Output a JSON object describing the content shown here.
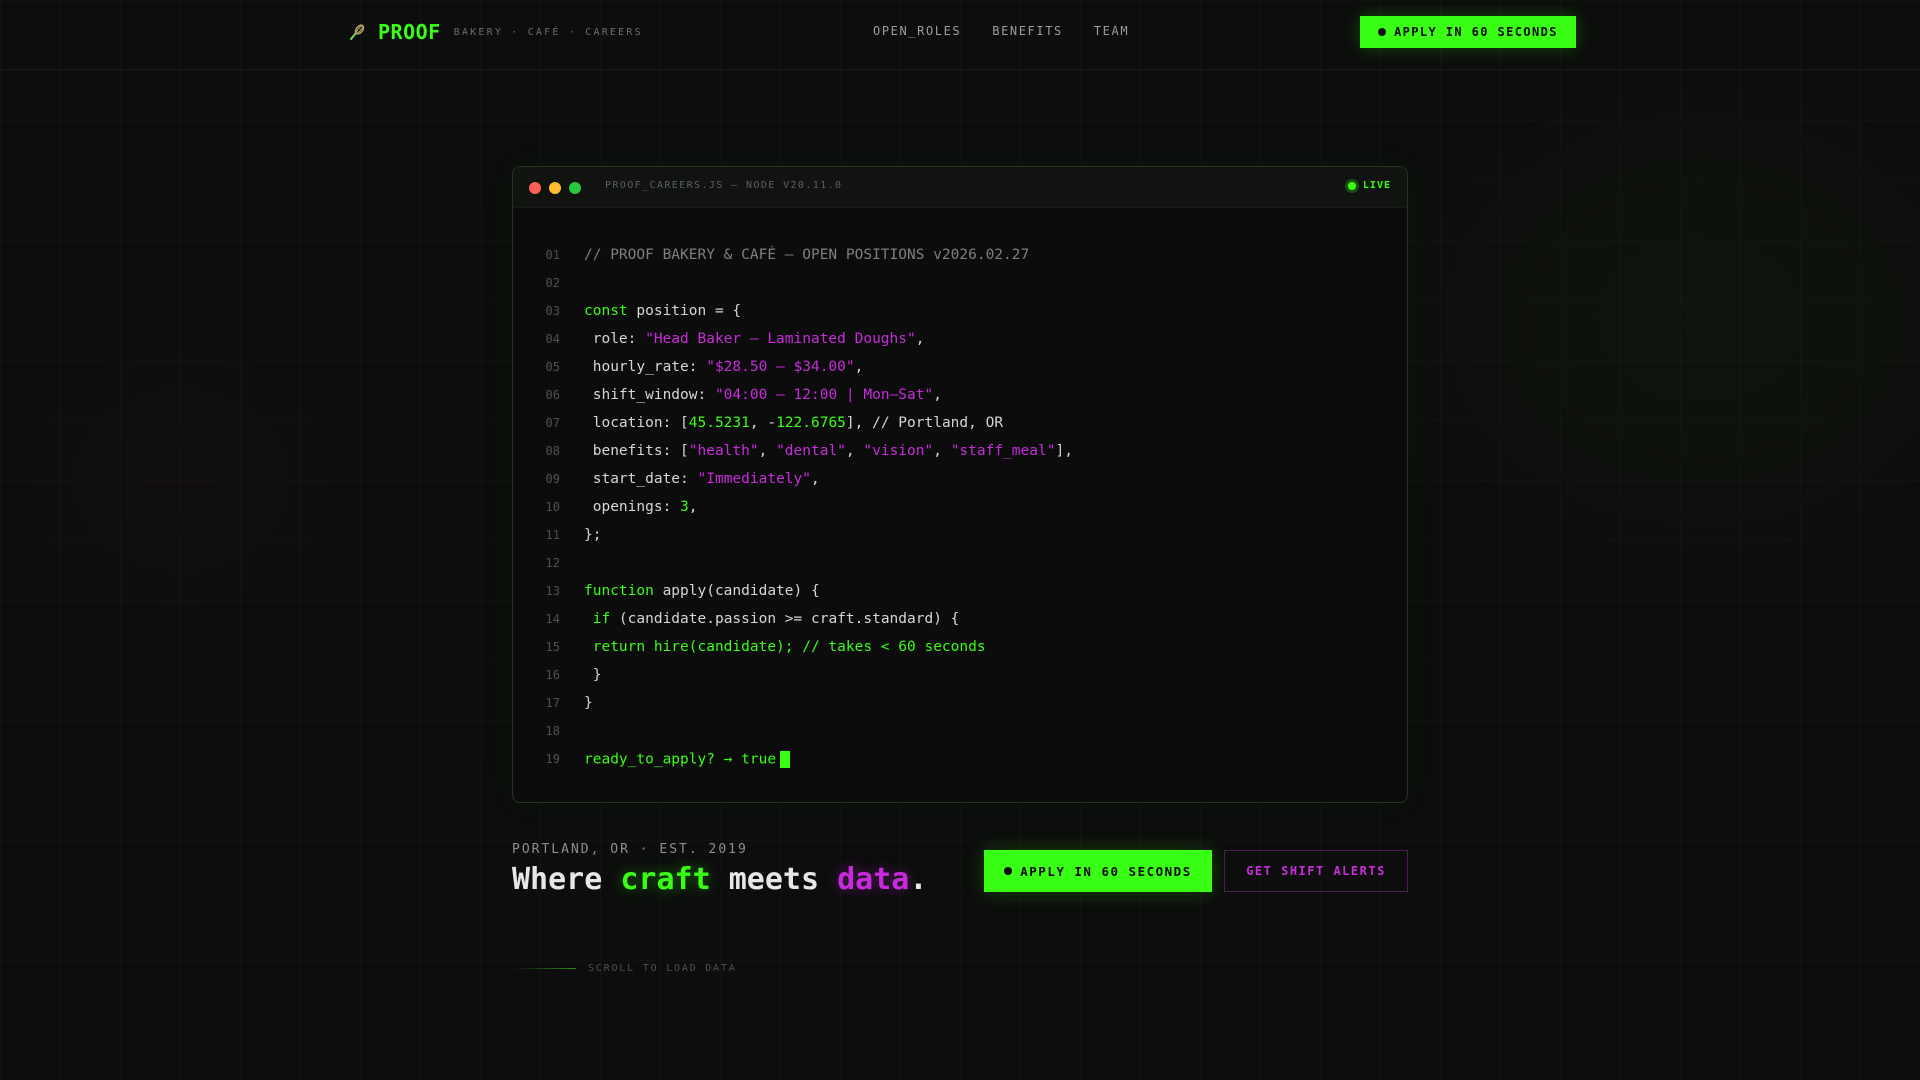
{
  "nav": {
    "brand_name": "PROOF",
    "brand_tagline": "BAKERY · CAFÉ · CAREERS",
    "brand_icon": "whisk-icon",
    "links": [
      "OPEN_ROLES",
      "BENEFITS",
      "TEAM"
    ],
    "cta_label": "APPLY IN 60 SECONDS"
  },
  "window": {
    "title": "PROOF_CAREERS.JS — NODE V20.11.0",
    "status_label": "LIVE",
    "lines": [
      {
        "n": "01",
        "tokens": [
          [
            "// PROOF BAKERY & CAFÉ — OPEN POSITIONS v2026.02.27",
            "com"
          ]
        ]
      },
      {
        "n": "02",
        "tokens": []
      },
      {
        "n": "03",
        "tokens": [
          [
            "const",
            "kw"
          ],
          [
            " position = {",
            "txt"
          ]
        ]
      },
      {
        "n": "04",
        "tokens": [
          [
            " role: ",
            "txt"
          ],
          [
            "\"Head Baker — Laminated Doughs\"",
            "str"
          ],
          [
            ",",
            "txt"
          ]
        ]
      },
      {
        "n": "05",
        "tokens": [
          [
            " hourly_rate: ",
            "txt"
          ],
          [
            "\"$28.50 – $34.00\"",
            "str"
          ],
          [
            ",",
            "txt"
          ]
        ]
      },
      {
        "n": "06",
        "tokens": [
          [
            " shift_window: ",
            "txt"
          ],
          [
            "\"04:00 – 12:00 | Mon–Sat\"",
            "str"
          ],
          [
            ",",
            "txt"
          ]
        ]
      },
      {
        "n": "07",
        "tokens": [
          [
            " location: [",
            "txt"
          ],
          [
            "45.5231",
            "num"
          ],
          [
            ", -",
            "txt"
          ],
          [
            "122.6765",
            "num"
          ],
          [
            "], // Portland, OR",
            "txt"
          ]
        ]
      },
      {
        "n": "08",
        "tokens": [
          [
            " benefits: [",
            "txt"
          ],
          [
            "\"health\"",
            "str"
          ],
          [
            ", ",
            "txt"
          ],
          [
            "\"dental\"",
            "str"
          ],
          [
            ", ",
            "txt"
          ],
          [
            "\"vision\"",
            "str"
          ],
          [
            ", ",
            "txt"
          ],
          [
            "\"staff_meal\"",
            "str"
          ],
          [
            "],",
            "txt"
          ]
        ]
      },
      {
        "n": "09",
        "tokens": [
          [
            " start_date: ",
            "txt"
          ],
          [
            "\"Immediately\"",
            "str"
          ],
          [
            ",",
            "txt"
          ]
        ]
      },
      {
        "n": "10",
        "tokens": [
          [
            " openings: ",
            "txt"
          ],
          [
            "3",
            "num"
          ],
          [
            ",",
            "txt"
          ]
        ]
      },
      {
        "n": "11",
        "tokens": [
          [
            "};",
            "txt"
          ]
        ]
      },
      {
        "n": "12",
        "tokens": []
      },
      {
        "n": "13",
        "tokens": [
          [
            "function",
            "kw"
          ],
          [
            " apply(candidate) {",
            "txt"
          ]
        ]
      },
      {
        "n": "14",
        "tokens": [
          [
            " ",
            "txt"
          ],
          [
            "if",
            "kw"
          ],
          [
            " (candidate.passion >= craft.standard) {",
            "txt"
          ]
        ]
      },
      {
        "n": "15",
        "tokens": [
          [
            " return hire(candidate); // takes < 60 seconds",
            "green"
          ]
        ]
      },
      {
        "n": "16",
        "tokens": [
          [
            " }",
            "txt"
          ]
        ]
      },
      {
        "n": "17",
        "tokens": [
          [
            "}",
            "txt"
          ]
        ]
      },
      {
        "n": "18",
        "tokens": []
      },
      {
        "n": "19",
        "tokens": [
          [
            "ready_to_apply? → true",
            "green"
          ]
        ],
        "cursor": true
      }
    ]
  },
  "hero": {
    "eyebrow": "PORTLAND, OR · EST. 2019",
    "headline_pre": "Where ",
    "headline_craft": "craft",
    "headline_mid": " meets ",
    "headline_data": "data",
    "headline_end": ".",
    "primary_cta": "APPLY IN 60 SECONDS",
    "secondary_cta": "GET SHIFT ALERTS"
  },
  "scroll_hint": "SCROLL TO LOAD DATA",
  "colors": {
    "accent_green": "#39ff14",
    "accent_magenta": "#c82bdc",
    "background": "#0c0d0c"
  }
}
